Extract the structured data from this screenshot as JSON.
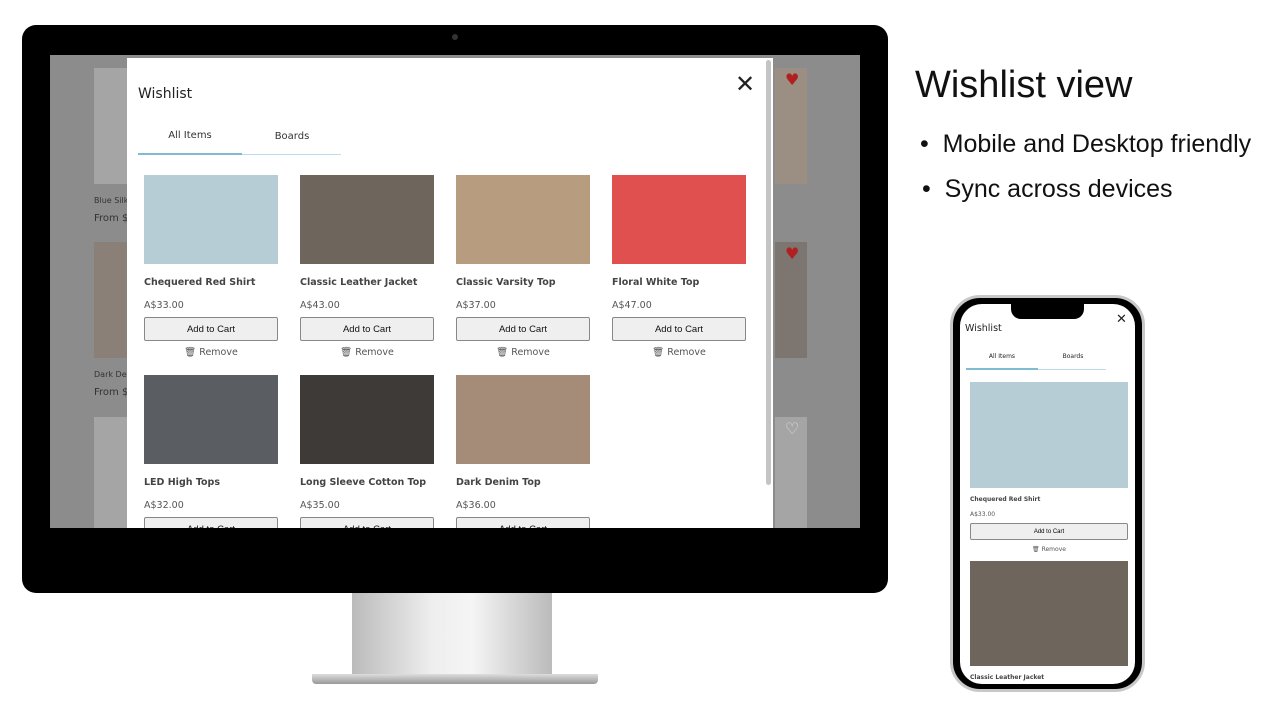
{
  "slide": {
    "headline": "Wishlist view",
    "bullets": [
      "Mobile and Desktop friendly",
      "Sync across devices"
    ]
  },
  "background_page": {
    "items": [
      {
        "name": "Blue Silk",
        "price": "From $"
      },
      {
        "name": "Dark Den",
        "price": "From $"
      }
    ]
  },
  "wishlist": {
    "title": "Wishlist",
    "close_icon": "close-icon",
    "tabs": [
      {
        "label": "All Items",
        "active": true
      },
      {
        "label": "Boards",
        "active": false
      }
    ],
    "add_to_cart_label": "Add to Cart",
    "remove_label": "Remove",
    "remove_icon": "trash-icon",
    "items": [
      {
        "name": "Chequered Red Shirt",
        "price": "A$33.00",
        "color": "#b7cdd6"
      },
      {
        "name": "Classic Leather Jacket",
        "price": "A$43.00",
        "color": "#6e655d"
      },
      {
        "name": "Classic Varsity Top",
        "price": "A$37.00",
        "color": "#b79c80"
      },
      {
        "name": "Floral White Top",
        "price": "A$47.00",
        "color": "#e0504f"
      },
      {
        "name": "LED High Tops",
        "price": "A$32.00",
        "color": "#5a5e62"
      },
      {
        "name": "Long Sleeve Cotton Top",
        "price": "A$35.00",
        "color": "#3e3a38"
      },
      {
        "name": "Dark Denim Top",
        "price": "A$36.00",
        "color": "#a58c78"
      }
    ]
  },
  "colors": {
    "tab_active": "#7fbcd2",
    "tab_inactive": "#b9dde9",
    "heart": "#b02020"
  }
}
